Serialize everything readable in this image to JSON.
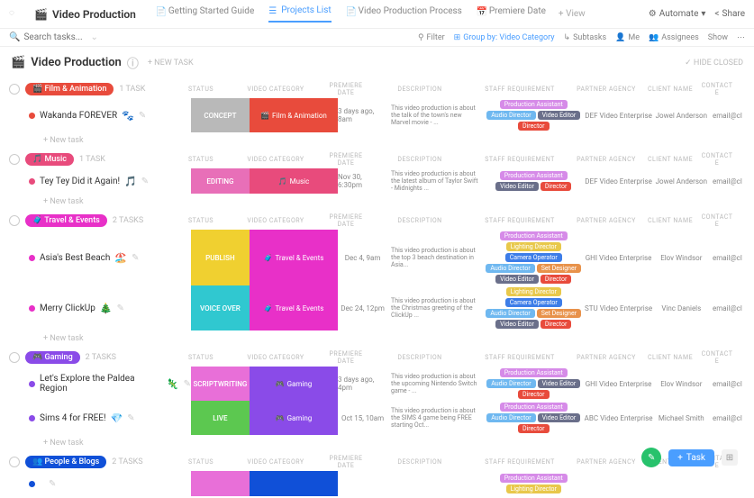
{
  "title": "Video Production",
  "tabs": [
    {
      "label": "Getting Started Guide"
    },
    {
      "label": "Projects List"
    },
    {
      "label": "Video Production Process"
    },
    {
      "label": "Premiere Date"
    }
  ],
  "add_view": "+ View",
  "automate": "Automate",
  "share": "Share",
  "search_placeholder": "Search tasks...",
  "filters": {
    "filter": "Filter",
    "group": "Group by: Video Category",
    "subtasks": "Subtasks",
    "me": "Me",
    "assignees": "Assignees",
    "show": "Show"
  },
  "header": {
    "title": "Video Production",
    "new_task": "+ NEW TASK",
    "hide_closed": "✓ HIDE CLOSED"
  },
  "col_labels": {
    "status": "STATUS",
    "cat": "VIDEO CATEGORY",
    "date": "PREMIERE DATE",
    "desc": "DESCRIPTION",
    "staff": "STAFF REQUIREMENT",
    "agency": "PARTNER AGENCY",
    "client": "CLIENT NAME",
    "contact": "CONTACT E"
  },
  "new_task_label": "+ New task",
  "tag_colors": {
    "prod_asst": {
      "label": "Production Assistant",
      "color": "#d68be8"
    },
    "audio_dir": {
      "label": "Audio Director",
      "color": "#6fb8f0"
    },
    "video_ed": {
      "label": "Video Editor",
      "color": "#6a6f8a"
    },
    "director": {
      "label": "Director",
      "color": "#e84b3c"
    },
    "light_dir": {
      "label": "Lighting Director",
      "color": "#e8c84b"
    },
    "cam_op": {
      "label": "Camera Operator",
      "color": "#3d7de8"
    },
    "set_des": {
      "label": "Set Designer",
      "color": "#e8924b"
    }
  },
  "groups": [
    {
      "name": "Film & Animation",
      "pill_color": "#e84b3c",
      "icon": "🎬",
      "count": "1 TASK",
      "tasks": [
        {
          "dot": "#e84b3c",
          "name": "Wakanda FOREVER",
          "emoji": "🐾",
          "status": {
            "label": "CONCEPT",
            "color": "#b9b9b9"
          },
          "cat": {
            "label": "Film & Animation",
            "color": "#e84b3c",
            "icon": "🎬"
          },
          "date": "3 days ago, 8am",
          "desc": "This video production is about the talk of the town's new Marvel movie - ...",
          "staff": [
            "prod_asst",
            "audio_dir",
            "video_ed",
            "director"
          ],
          "agency": "DEF Video Enterprise",
          "client": "Jowel Anderson",
          "contact": "email@cl"
        }
      ]
    },
    {
      "name": "Music",
      "pill_color": "#e84b7c",
      "icon": "🎵",
      "count": "1 TASK",
      "tasks": [
        {
          "dot": "#e84b7c",
          "name": "Tey Tey Did it Again!",
          "emoji": "🎵",
          "status": {
            "label": "EDITING",
            "color": "#e86fb8"
          },
          "cat": {
            "label": "Music",
            "color": "#e84b7c",
            "icon": "🎵"
          },
          "date": "Nov 30, 6:30pm",
          "desc": "This video production is about the latest album of Taylor Swift - Midnights ...",
          "staff": [
            "prod_asst",
            "video_ed",
            "director"
          ],
          "agency": "DEF Video Enterprise",
          "client": "Jowel Anderson",
          "contact": "email@cl"
        }
      ]
    },
    {
      "name": "Travel & Events",
      "pill_color": "#e830c8",
      "icon": "🧳",
      "count": "2 TASKS",
      "tasks": [
        {
          "dot": "#e830c8",
          "name": "Asia's Best Beach",
          "emoji": "🏖️",
          "status": {
            "label": "PUBLISH",
            "color": "#f0d030"
          },
          "cat": {
            "label": "Travel & Events",
            "color": "#e830c8",
            "icon": "🧳"
          },
          "date": "Dec 4, 9am",
          "desc": "This video production is about the top 3 beach destination in Asia...",
          "staff": [
            "prod_asst",
            "light_dir",
            "cam_op",
            "audio_dir",
            "set_des",
            "video_ed",
            "director"
          ],
          "agency": "GHI Video Enterprise",
          "client": "Elov Windsor",
          "contact": "email@cl"
        },
        {
          "dot": "#e830c8",
          "name": "Merry ClickUp",
          "emoji": "🎄",
          "status": {
            "label": "VOICE OVER",
            "color": "#30c8d0"
          },
          "cat": {
            "label": "Travel & Events",
            "color": "#e830c8",
            "icon": "🧳"
          },
          "date": "Dec 24, 12pm",
          "desc": "This video production is about the Christmas greeting of the ClickUp ...",
          "staff": [
            "light_dir",
            "cam_op",
            "audio_dir",
            "set_des",
            "video_ed",
            "director"
          ],
          "agency": "STU Video Enterprise",
          "client": "Vinc Daniels",
          "contact": "email@cl"
        }
      ]
    },
    {
      "name": "Gaming",
      "pill_color": "#8a4be8",
      "icon": "🎮",
      "count": "2 TASKS",
      "tasks": [
        {
          "dot": "#8a4be8",
          "name": "Let's Explore the Paldea Region",
          "emoji": "🦎",
          "status": {
            "label": "SCRIPTWRITING",
            "color": "#e86fd8"
          },
          "cat": {
            "label": "Gaming",
            "color": "#8a4be8",
            "icon": "🎮"
          },
          "date": "3 days ago, 4pm",
          "desc": "This video production is about the upcoming Nintendo Switch game - ...",
          "staff": [
            "prod_asst",
            "audio_dir",
            "video_ed",
            "director"
          ],
          "agency": "GHI Video Enterprise",
          "client": "Elov Windsor",
          "contact": "email@cl"
        },
        {
          "dot": "#8a4be8",
          "name": "Sims 4 for FREE!",
          "emoji": "💎",
          "status": {
            "label": "LIVE",
            "color": "#5cc850"
          },
          "cat": {
            "label": "Gaming",
            "color": "#8a4be8",
            "icon": "🎮"
          },
          "date": "Oct 15, 10am",
          "desc": "This video production is about the SIMS 4 game being FREE starting Oct...",
          "staff": [
            "prod_asst",
            "audio_dir",
            "video_ed",
            "director"
          ],
          "agency": "ABC Video Enterprise",
          "client": "Michael Smith",
          "contact": "email@cl"
        }
      ]
    },
    {
      "name": "People & Blogs",
      "pill_color": "#1050d8",
      "icon": "👥",
      "count": "2 TASKS",
      "tasks": [
        {
          "dot": "#1050d8",
          "name": "",
          "emoji": "",
          "status": {
            "label": "",
            "color": "#e86fd8"
          },
          "cat": {
            "label": "",
            "color": "#1050d8",
            "icon": ""
          },
          "date": "",
          "desc": "",
          "staff": [
            "prod_asst",
            "light_dir"
          ],
          "agency": "",
          "client": "",
          "contact": ""
        }
      ]
    }
  ],
  "fab_task": "Task"
}
